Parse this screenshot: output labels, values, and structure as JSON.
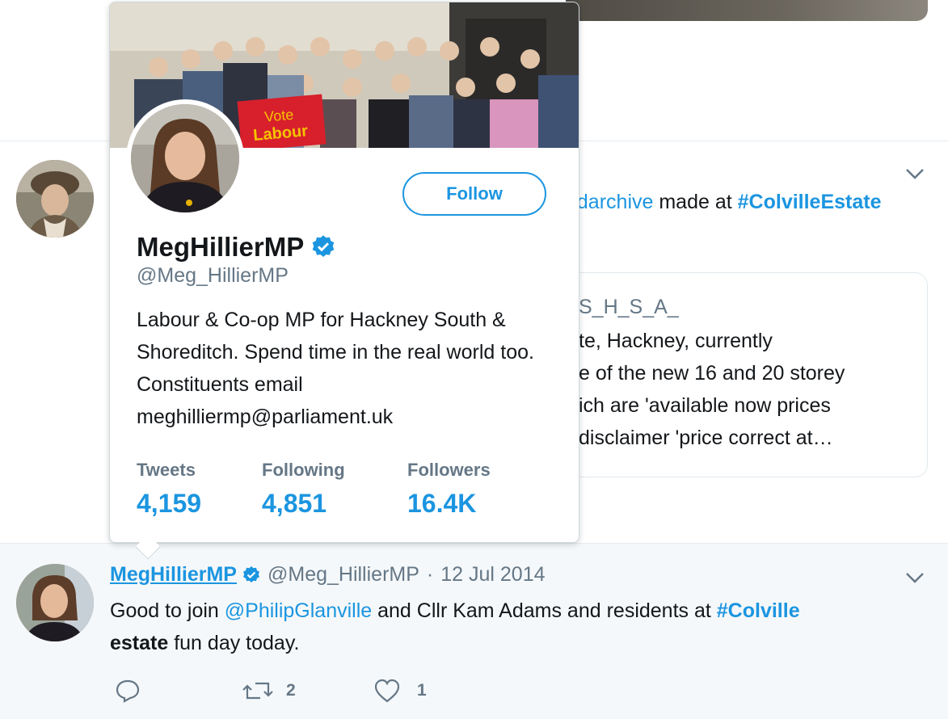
{
  "middle_tweet": {
    "text_prefix": "ndarchive",
    "text_mid": " made at ",
    "hashtag": "#ColvilleEstate",
    "card": {
      "title": "S_H_S_A_",
      "lines": [
        "te, Hackney, currently",
        "e of the new 16 and 20 storey",
        "ich are 'available now prices",
        "disclaimer 'price correct at…"
      ]
    }
  },
  "hover_card": {
    "name": "MegHillierMP",
    "handle": "@Meg_HillierMP",
    "follow_label": "Follow",
    "banner_sign": [
      "Vote",
      "Labour"
    ],
    "bio": "Labour & Co-op MP for Hackney South & Shoreditch. Spend time in the real world too. Constituents email meghilliermp@parliament.uk",
    "stats": [
      {
        "label": "Tweets",
        "value": "4,159"
      },
      {
        "label": "Following",
        "value": "4,851"
      },
      {
        "label": "Followers",
        "value": "16.4K"
      }
    ]
  },
  "bottom_tweet": {
    "name": "MegHillierMP",
    "handle": "@Meg_HillierMP",
    "separator": "·",
    "date": "12 Jul 2014",
    "text": {
      "part1": "Good to join ",
      "mention": "@PhilipGlanville",
      "part2": " and Cllr Kam Adams and residents at ",
      "hashtag": "#Colville",
      "bold": "estate",
      "part3": " fun day today."
    },
    "actions": {
      "retweets": "2",
      "likes": "1"
    }
  },
  "colors": {
    "link": "#1b95e0",
    "muted": "#657786",
    "border": "#e6ecf0",
    "hover_bg": "#f5f8fa"
  }
}
